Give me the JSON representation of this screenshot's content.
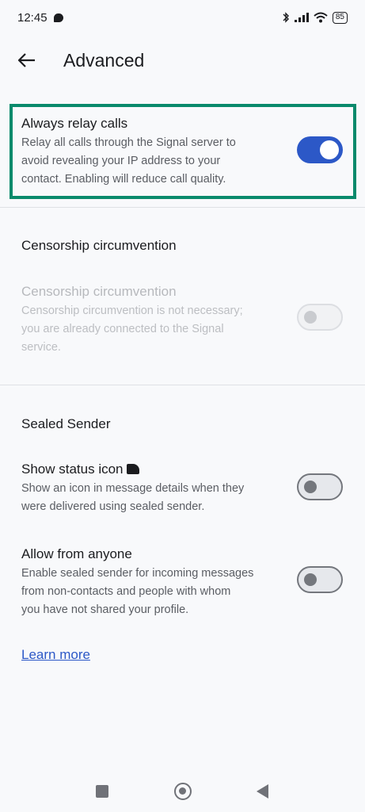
{
  "status_bar": {
    "time": "12:45",
    "battery": "85"
  },
  "app_bar": {
    "title": "Advanced"
  },
  "relay": {
    "title": "Always relay calls",
    "subtitle_lines": [
      "Relay all calls through the Signal server to",
      "avoid revealing your IP address to your",
      "contact. Enabling will reduce call quality."
    ],
    "enabled": true
  },
  "censorship": {
    "section": "Censorship circumvention",
    "title": "Censorship circumvention",
    "subtitle_lines": [
      "Censorship circumvention is not necessary;",
      "you are already connected to the Signal",
      "service."
    ],
    "enabled": false,
    "disabled": true
  },
  "sealed": {
    "section": "Sealed Sender",
    "status_icon": {
      "title": "Show status icon",
      "subtitle_lines": [
        "Show an icon in message details when they",
        "were delivered using sealed sender."
      ],
      "enabled": false
    },
    "anyone": {
      "title": "Allow from anyone",
      "subtitle_lines": [
        "Enable sealed sender for incoming messages",
        "from non-contacts and people with whom",
        "you have not shared your profile."
      ],
      "enabled": false
    },
    "learn_more": "Learn more"
  },
  "colors": {
    "accent": "#2c58c7",
    "highlight": "#0a8a6c"
  }
}
